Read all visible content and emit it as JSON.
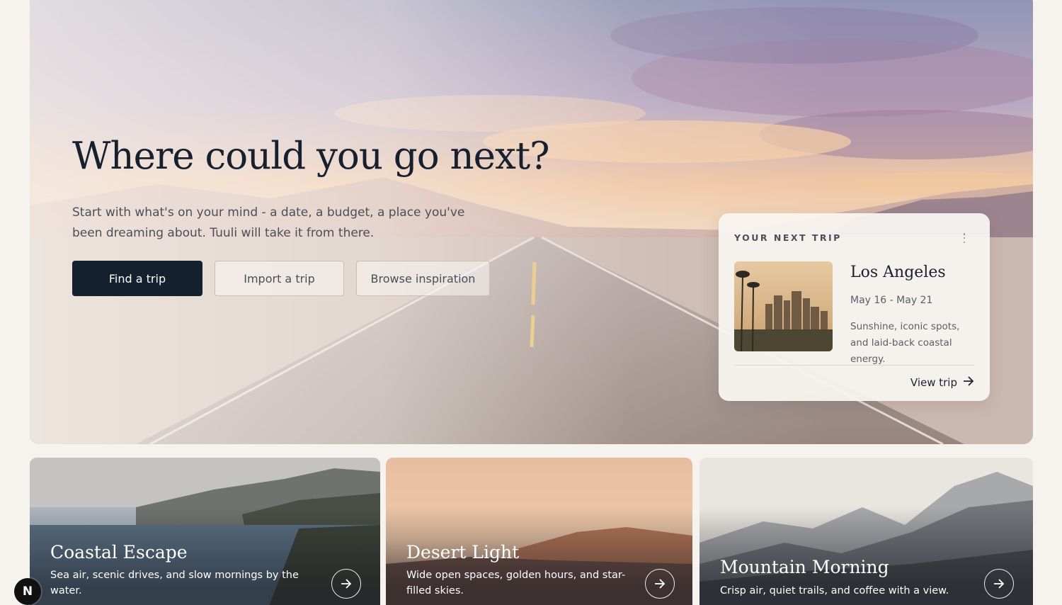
{
  "hero": {
    "title": "Where could you go next?",
    "subtitle": "Start with what's on your mind - a date, a budget, a place you've been dreaming about. Tuuli will take it from there.",
    "buttons": {
      "find": "Find a trip",
      "import": "Import a trip",
      "browse": "Browse inspiration"
    }
  },
  "next_trip": {
    "eyebrow": "YOUR NEXT TRIP",
    "city": "Los Angeles",
    "dates": "May 16 - May 21",
    "description": "Sunshine, iconic spots, and laid-back coastal energy.",
    "link": "View trip",
    "icons": {
      "menu": "more-vertical-icon",
      "arrow": "arrow-right-icon"
    }
  },
  "collections": [
    {
      "title": "Coastal Escape",
      "description": "Sea air, scenic drives, and slow mornings by the water."
    },
    {
      "title": "Desert Light",
      "description": "Wide open spaces, golden hours, and star-filled skies."
    },
    {
      "title": "Mountain Morning",
      "description": "Crisp air, quiet trails, and coffee with a view."
    }
  ],
  "badge": {
    "label": "N"
  },
  "colors": {
    "background": "#f6f3ef",
    "primary": "#14202e",
    "text": "#16202e",
    "muted": "#4a4f59"
  }
}
